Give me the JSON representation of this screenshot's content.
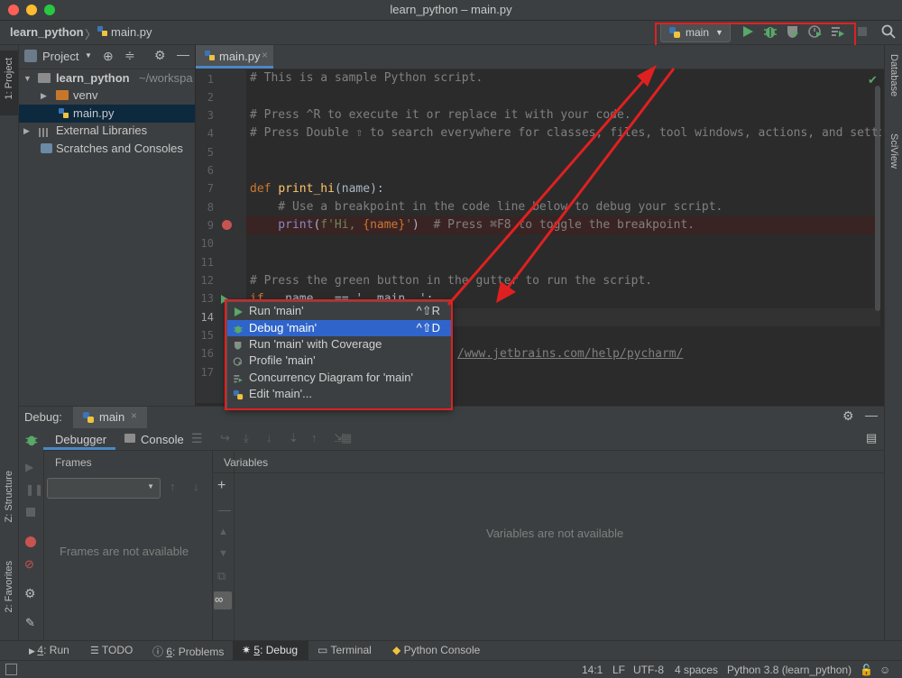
{
  "window": {
    "title": "learn_python – main.py"
  },
  "navbar": {
    "project": "learn_python",
    "separator": "〉",
    "file": "main.py",
    "run_config": "main"
  },
  "left_strip": {
    "project_tab": "1: Project",
    "structure_tab": "Z: Structure",
    "favorites_tab": "2: Favorites"
  },
  "right_strip": {
    "database_tab": "Database",
    "sciview_tab": "SciView"
  },
  "project_panel": {
    "title": "Project",
    "items": [
      {
        "label": "learn_python",
        "suffix": "~/workspa"
      },
      {
        "label": "venv"
      },
      {
        "label": "main.py"
      },
      {
        "label": "External Libraries"
      },
      {
        "label": "Scratches and Consoles"
      }
    ]
  },
  "editor": {
    "tab": "main.py",
    "line_numbers": [
      "1",
      "2",
      "3",
      "4",
      "5",
      "6",
      "7",
      "8",
      "9",
      "10",
      "11",
      "12",
      "13",
      "14",
      "15",
      "16",
      "17"
    ],
    "lines": {
      "l1": "# This is a sample Python script.",
      "l3": "# Press ^R to execute it or replace it with your code.",
      "l4": "# Press Double ⇧ to search everywhere for classes, files, tool windows, actions, and settings.",
      "l7_kw": "def ",
      "l7_fn": "print_hi",
      "l7_rest": "(name):",
      "l8": "    # Use a breakpoint in the code line below to debug your script.",
      "l9_bi": "    print",
      "l9_p1": "(",
      "l9_st1": "f'Hi, ",
      "l9_var": "{name}",
      "l9_st2": "'",
      "l9_p2": ")",
      "l9_cm": "  # Press ⌘F8 to toggle the breakpoint.",
      "l12": "# Press the green button in the gutter to run the script.",
      "l13_kw": "if ",
      "l13_rest": "__name__ == '__main__':",
      "l16": "/www.jetbrains.com/help/pycharm/"
    }
  },
  "run_popup": {
    "items": [
      {
        "label": "Run 'main'",
        "shortcut": "^⇧R"
      },
      {
        "label": "Debug 'main'",
        "shortcut": "^⇧D"
      },
      {
        "label": "Run 'main' with Coverage",
        "shortcut": ""
      },
      {
        "label": "Profile 'main'",
        "shortcut": ""
      },
      {
        "label": "Concurrency Diagram for 'main'",
        "shortcut": ""
      },
      {
        "label": "Edit 'main'...",
        "shortcut": ""
      }
    ]
  },
  "debug": {
    "label": "Debug:",
    "session": "main",
    "tab_debugger": "Debugger",
    "tab_console": "Console",
    "frames_title": "Frames",
    "frames_empty": "Frames are not available",
    "variables_title": "Variables",
    "variables_empty": "Variables are not available"
  },
  "bottom_tools": [
    {
      "num": "4",
      "label": ": Run"
    },
    {
      "num": "",
      "label": "TODO"
    },
    {
      "num": "6",
      "label": ": Problems"
    },
    {
      "num": "5",
      "label": ": Debug"
    },
    {
      "num": "",
      "label": "Terminal"
    },
    {
      "num": "",
      "label": "Python Console"
    }
  ],
  "status": {
    "position": "14:1",
    "line_sep": "LF",
    "encoding": "UTF-8",
    "indent": "4 spaces",
    "interpreter": "Python 3.8 (learn_python)"
  },
  "colors": {
    "accent": "#2f65ca",
    "annotation_red": "#e02020",
    "run_green": "#59a869"
  }
}
